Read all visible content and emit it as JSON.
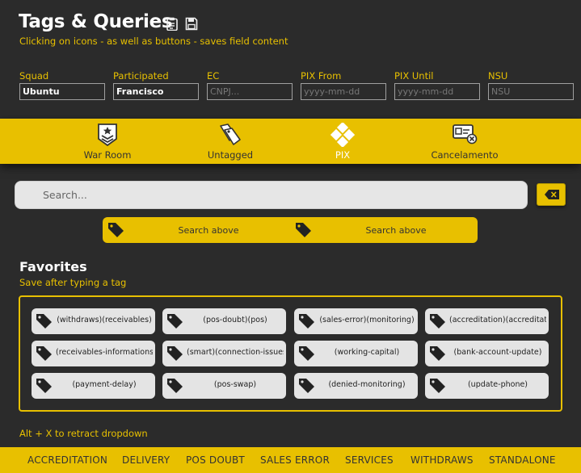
{
  "header": {
    "title": "Tags & Queries",
    "subtitle": "Clicking on icons - as well as buttons - saves field content",
    "icons": [
      "clipboard-icon",
      "save-icon"
    ]
  },
  "fields": [
    {
      "label": "Squad",
      "value": "Ubuntu",
      "placeholder": ""
    },
    {
      "label": "Participated",
      "value": "Francisco",
      "placeholder": ""
    },
    {
      "label": "EC",
      "value": "",
      "placeholder": "CNPJ..."
    },
    {
      "label": "PIX From",
      "value": "",
      "placeholder": "yyyy-mm-dd"
    },
    {
      "label": "PIX Until",
      "value": "",
      "placeholder": "yyyy-mm-dd"
    },
    {
      "label": "NSU",
      "value": "",
      "placeholder": "NSU"
    }
  ],
  "nav": [
    {
      "label": "War Room",
      "icon": "badge-icon"
    },
    {
      "label": "Untagged",
      "icon": "tags-icon"
    },
    {
      "label": "PIX",
      "icon": "pix-icon"
    },
    {
      "label": "Cancelamento",
      "icon": "cancel-card-icon"
    }
  ],
  "search": {
    "placeholder": "Search...",
    "clear_icon": "backspace-icon",
    "buttons": [
      "Search above",
      "Search above"
    ]
  },
  "favorites": {
    "title": "Favorites",
    "subtitle": "Save after typing a tag",
    "tags": [
      "(withdraws)(receivables)",
      "(pos-doubt)(pos)",
      "(sales-error)(monitoring)",
      "(accreditation)(accreditation",
      "(receivables-informations)",
      "(smart)(connection-issues",
      "(working-capital)",
      "(bank-account-update)",
      "(payment-delay)",
      "(pos-swap)",
      "(denied-monitoring)",
      "(update-phone)"
    ]
  },
  "hint": "Alt + X to retract dropdown",
  "bottom_nav": [
    "ACCREDITATION",
    "DELIVERY",
    "POS DOUBT",
    "SALES ERROR",
    "SERVICES",
    "WITHDRAWS",
    "STANDALONE"
  ],
  "colors": {
    "accent": "#e8c000",
    "background": "#2b2b2b",
    "tag_bg": "#e4e4e4"
  }
}
